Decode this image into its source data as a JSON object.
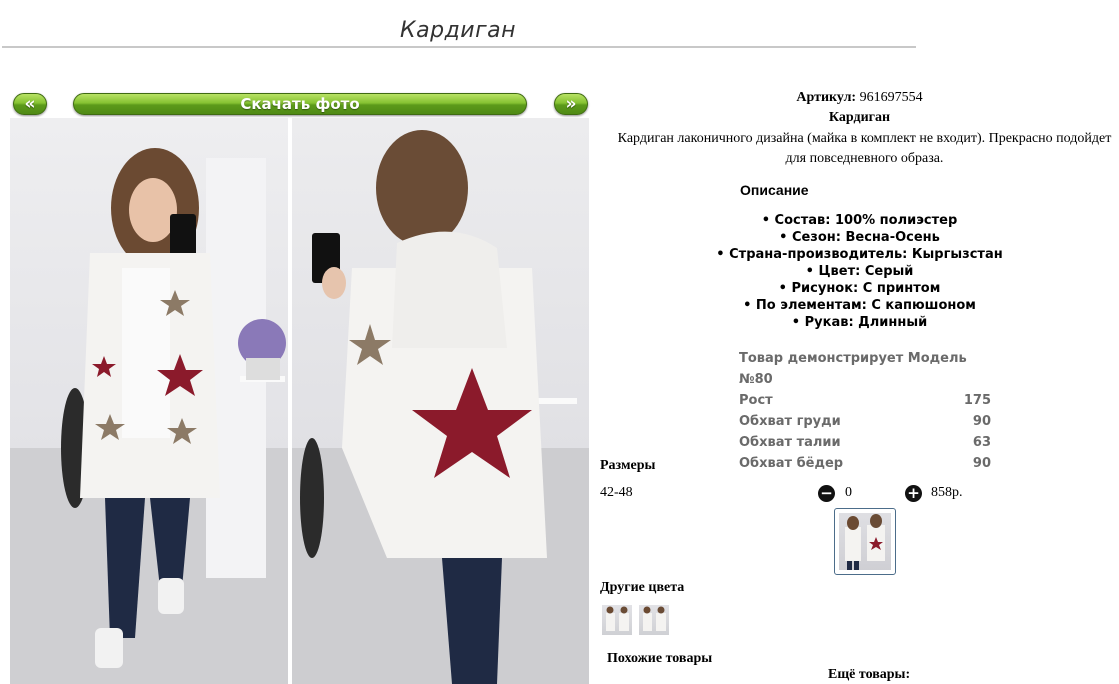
{
  "page": {
    "title": "Кардиган"
  },
  "gallery": {
    "prev_label": "«",
    "next_label": "»",
    "download_label": "Скачать фото"
  },
  "product": {
    "article_label": "Артикул:",
    "article_value": "961697554",
    "name": "Кардиган",
    "description": "Кардиган лаконичного дизайна (майка в комплект не входит). Прекрасно подойдет для повседневного образа.",
    "details_heading": "Описание",
    "features": [
      "Состав: 100% полиэстер",
      "Сезон: Весна-Осень",
      "Страна-производитель: Кыргызстан",
      "Цвет: Серый",
      "Рисунок: С принтом",
      "По элементам: С капюшоном",
      "Рукав: Длинный"
    ]
  },
  "model": {
    "heading": "Товар демонстрирует Модель №80",
    "rows": [
      {
        "label": "Рост",
        "value": "175"
      },
      {
        "label": "Обхват груди",
        "value": "90"
      },
      {
        "label": "Обхват талии",
        "value": "63"
      },
      {
        "label": "Обхват бёдер",
        "value": "90"
      }
    ]
  },
  "sizes": {
    "heading": "Размеры",
    "size": "42-48",
    "minus_icon": "minus-circle-icon",
    "quantity": "0",
    "plus_icon": "plus-circle-icon",
    "price": "858р."
  },
  "other_colors": {
    "heading": "Другие цвета"
  },
  "similar": {
    "heading": "Похожие товары"
  },
  "more": {
    "heading": "Ещё товары:"
  },
  "colors": {
    "button_green": "#86c232",
    "button_border": "#3f6b12",
    "star_red": "#8b1a2b",
    "star_taupe": "#8c7a66"
  }
}
